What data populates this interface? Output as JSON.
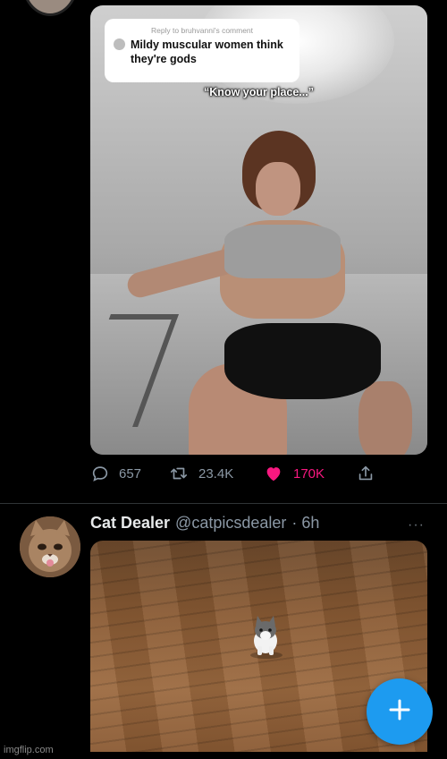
{
  "tweet1": {
    "overlay": {
      "reply_to": "Reply to bruhvanni's comment",
      "reply_text": "Mildy muscular women think they're gods",
      "caption": "“Know your place...”"
    },
    "actions": {
      "replies": "657",
      "retweets": "23.4K",
      "likes": "170K"
    }
  },
  "tweet2": {
    "display_name": "Cat Dealer",
    "handle": "@catpicsdealer",
    "time": "· 6h",
    "more": "···"
  },
  "fab": {
    "icon": "plus-icon"
  },
  "watermark": "imgflip.com",
  "colors": {
    "like": "#f91880",
    "accent": "#1d9bf0",
    "muted": "#8b98a5"
  }
}
